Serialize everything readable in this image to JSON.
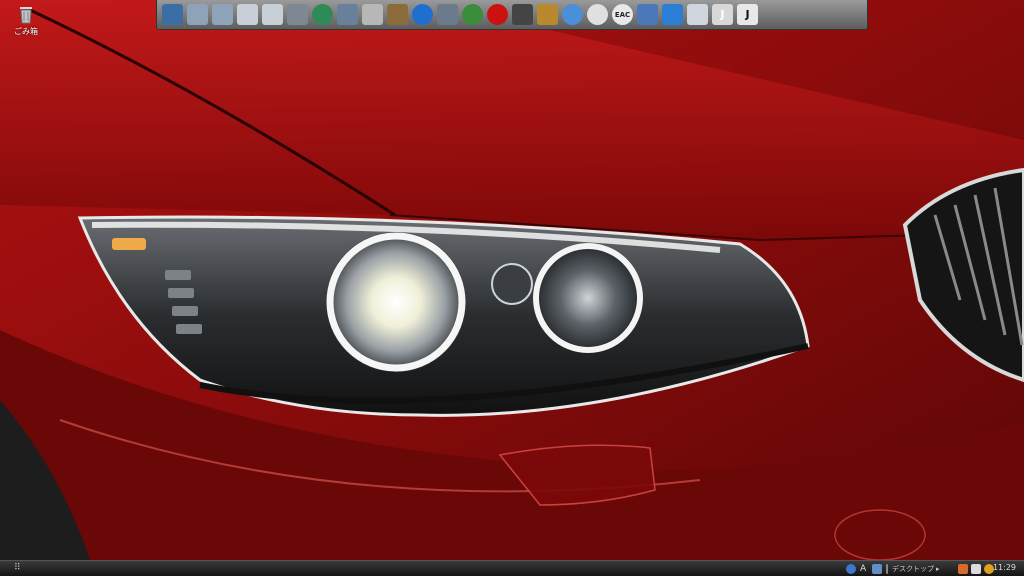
{
  "desktop": {
    "recycle_bin_label": "ごみ箱"
  },
  "dock": {
    "items": [
      {
        "name": "desktop",
        "icon": "monitor-icon",
        "color": "#3a6ea5"
      },
      {
        "name": "folder-1",
        "icon": "folder-icon",
        "color": "#8fa3b8"
      },
      {
        "name": "folder-2",
        "icon": "folder-icon",
        "color": "#8fa3b8"
      },
      {
        "name": "document-1",
        "icon": "document-icon",
        "color": "#c9cfd6"
      },
      {
        "name": "document-2",
        "icon": "document-icon",
        "color": "#c9cfd6"
      },
      {
        "name": "camera",
        "icon": "camera-icon",
        "color": "#7d8893"
      },
      {
        "name": "media-center",
        "icon": "media-icon",
        "color": "#2e8b57"
      },
      {
        "name": "guitar",
        "icon": "guitar-icon",
        "color": "#6a7f9a"
      },
      {
        "name": "tools",
        "icon": "tools-icon",
        "color": "#b7b7b7"
      },
      {
        "name": "photo",
        "icon": "photo-icon",
        "color": "#8b6a3c"
      },
      {
        "name": "media-player",
        "icon": "play-icon",
        "color": "#1f6fd1"
      },
      {
        "name": "computer",
        "icon": "computer-icon",
        "color": "#6b7b8c"
      },
      {
        "name": "network",
        "icon": "globe-icon",
        "color": "#3a8d3a"
      },
      {
        "name": "opera",
        "icon": "opera-icon",
        "color": "#cc1111"
      },
      {
        "name": "game",
        "icon": "game-icon",
        "color": "#444444"
      },
      {
        "name": "security",
        "icon": "security-icon",
        "color": "#b98a2d"
      },
      {
        "name": "safari",
        "icon": "compass-icon",
        "color": "#4a8fd8"
      },
      {
        "name": "chrome",
        "icon": "chrome-icon",
        "color": "#e0e0e0"
      },
      {
        "name": "eac",
        "icon": "eac-icon",
        "color": "#e8e8e8",
        "text": "EAC"
      },
      {
        "name": "settings",
        "icon": "window-icon",
        "color": "#4a78b8"
      },
      {
        "name": "internet-explorer",
        "icon": "ie-icon",
        "color": "#2a7fd4"
      },
      {
        "name": "mail",
        "icon": "mail-icon",
        "color": "#d0d6de"
      },
      {
        "name": "j-light",
        "icon": "j-light-icon",
        "color": "#d8d8d8",
        "text": "J"
      },
      {
        "name": "j-dark",
        "icon": "j-dark-icon",
        "color": "#e8e8e8",
        "text": "J"
      }
    ]
  },
  "taskbar": {
    "start_label": "⠿",
    "deskbar_label": "デスクトップ",
    "deskbar_arrow": "▸",
    "clock": "11:29"
  }
}
